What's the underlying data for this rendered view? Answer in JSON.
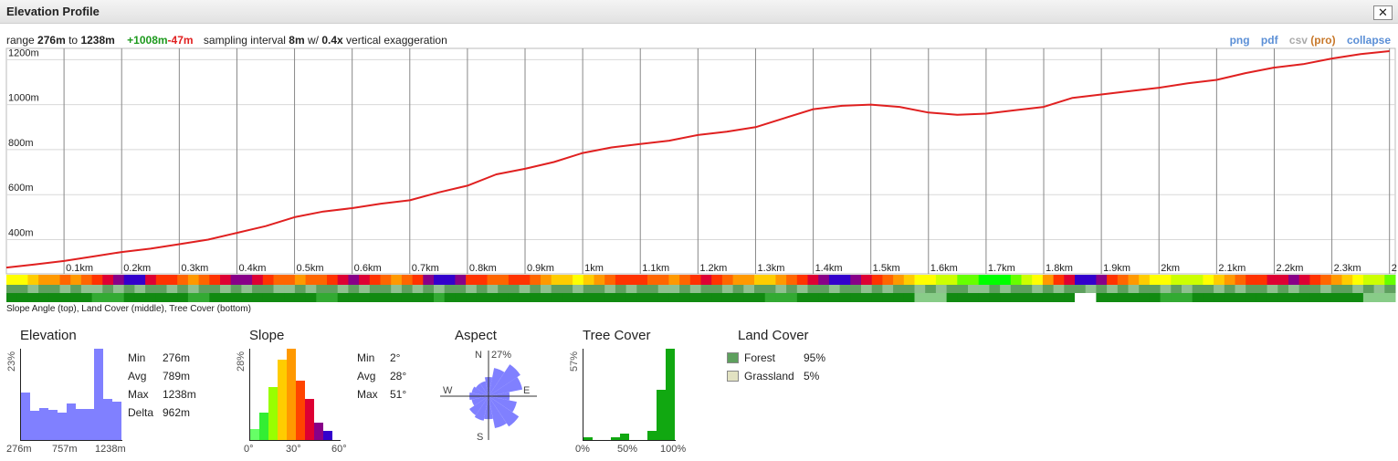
{
  "window": {
    "title": "Elevation Profile",
    "close_label": "✕"
  },
  "summary": {
    "range_prefix": "range",
    "range_min": "276m",
    "range_to": "to",
    "range_max": "1238m",
    "gain": "+1008m",
    "loss": "-47m",
    "sampling_prefix": "sampling interval",
    "sampling_value": "8m",
    "sampling_mid": "w/",
    "exaggeration_value": "0.4x",
    "exaggeration_suffix": "vertical exaggeration"
  },
  "tools": {
    "png": "png",
    "pdf": "pdf",
    "csv": "csv",
    "pro": "(pro)",
    "collapse": "collapse"
  },
  "colors": {
    "profile_line": "#e02020",
    "gain": "#1e9a1e",
    "loss": "#e02020",
    "link": "#5b8fd6",
    "histogram": "#8080ff",
    "tree_cover": "#11a811"
  },
  "chart_data": {
    "type": "line",
    "y_ticks": [
      "1200m",
      "1000m",
      "800m",
      "600m",
      "400m"
    ],
    "y_tick_values": [
      1200,
      1000,
      800,
      600,
      400
    ],
    "x_ticks": [
      "0.1km",
      "0.2km",
      "0.3km",
      "0.4km",
      "0.5km",
      "0.6km",
      "0.7km",
      "0.8km",
      "0.9km",
      "1km",
      "1.1km",
      "1.2km",
      "1.3km",
      "1.4km",
      "1.5km",
      "1.6km",
      "1.7km",
      "1.8km",
      "1.9km",
      "2km",
      "2.1km",
      "2.2km",
      "2.3km",
      "2"
    ],
    "x_tick_values": [
      0.1,
      0.2,
      0.3,
      0.4,
      0.5,
      0.6,
      0.7,
      0.8,
      0.9,
      1.0,
      1.1,
      1.2,
      1.3,
      1.4,
      1.5,
      1.6,
      1.7,
      1.8,
      1.9,
      2.0,
      2.1,
      2.2,
      2.3,
      2.4
    ],
    "x_range_km": [
      0,
      2.41
    ],
    "y_range_m": [
      248,
      1250
    ],
    "grid": true,
    "units": {
      "x": "km",
      "y": "m"
    },
    "series": [
      {
        "x_km": [
          0,
          0.05,
          0.1,
          0.15,
          0.2,
          0.25,
          0.3,
          0.35,
          0.4,
          0.45,
          0.5,
          0.55,
          0.6,
          0.65,
          0.7,
          0.75,
          0.8,
          0.85,
          0.9,
          0.95,
          1.0,
          1.05,
          1.1,
          1.15,
          1.2,
          1.25,
          1.3,
          1.35,
          1.4,
          1.45,
          1.5,
          1.55,
          1.6,
          1.65,
          1.7,
          1.75,
          1.8,
          1.85,
          1.9,
          1.95,
          2.0,
          2.05,
          2.1,
          2.15,
          2.2,
          2.25,
          2.3,
          2.35,
          2.4
        ],
        "elevation_m": [
          276,
          290,
          305,
          325,
          345,
          360,
          380,
          400,
          430,
          460,
          500,
          525,
          540,
          560,
          575,
          610,
          640,
          690,
          715,
          745,
          785,
          810,
          825,
          840,
          865,
          880,
          900,
          940,
          980,
          995,
          1000,
          990,
          965,
          955,
          960,
          975,
          990,
          1030,
          1045,
          1060,
          1075,
          1095,
          1110,
          1140,
          1165,
          1180,
          1205,
          1225,
          1238
        ]
      }
    ]
  },
  "strips": {
    "caption": "Slope Angle (top), Land Cover (middle), Tree Cover (bottom)",
    "slope_colors": [
      "#00ff00",
      "#66ff00",
      "#ccff00",
      "#ffff00",
      "#ffcc00",
      "#ff9900",
      "#ff6600",
      "#ff3300",
      "#dd0033",
      "#880088",
      "#3300cc"
    ],
    "slope_angles_deg": [
      18,
      20,
      24,
      26,
      28,
      30,
      29,
      32,
      36,
      40,
      44,
      50,
      48,
      40,
      36,
      34,
      30,
      28,
      30,
      34,
      38,
      42,
      44,
      40,
      36,
      32,
      30,
      28,
      30,
      32,
      36,
      40,
      42,
      38,
      34,
      30,
      28,
      32,
      36,
      44,
      48,
      46,
      42,
      36,
      34,
      30,
      32,
      36,
      34,
      30,
      28,
      24,
      22,
      20,
      22,
      26,
      30,
      34,
      36,
      34,
      32,
      30,
      28,
      30,
      34,
      38,
      36,
      32,
      28,
      26,
      24,
      22,
      26,
      30,
      34,
      40,
      44,
      48,
      46,
      42,
      38,
      34,
      30,
      26,
      22,
      20,
      18,
      16,
      14,
      12,
      10,
      8,
      6,
      8,
      10,
      14,
      20,
      28,
      34,
      38,
      46,
      50,
      44,
      36,
      30,
      26,
      22,
      20,
      18,
      16,
      14,
      16,
      18,
      22,
      26,
      30,
      34,
      36,
      38,
      40,
      42,
      38,
      34,
      30,
      26,
      22,
      18,
      16,
      14,
      12
    ],
    "land_cover_colors": [
      "#5ea05e",
      "#8fc08f"
    ],
    "land_cover_pattern": [
      0,
      0,
      1,
      0,
      0,
      1,
      0,
      1,
      1,
      0,
      1,
      0,
      1,
      0,
      0,
      1,
      0,
      1,
      0,
      0,
      1,
      0,
      1,
      0,
      0,
      1,
      1,
      0,
      1,
      0,
      0,
      1,
      0,
      1,
      0,
      0,
      1,
      0,
      1,
      0,
      1,
      0,
      0,
      1,
      0,
      1,
      0,
      0,
      1,
      0,
      1,
      0,
      0,
      1,
      0,
      0,
      1,
      0,
      1,
      0,
      0,
      1,
      1,
      0,
      1,
      0,
      0,
      1,
      0,
      1,
      0,
      0,
      1,
      0,
      1,
      0,
      0,
      1,
      0,
      0,
      1,
      0,
      1,
      0,
      0,
      1,
      0,
      1,
      0,
      0,
      1,
      1,
      0,
      1,
      0,
      0,
      1,
      0,
      1,
      0,
      0,
      1,
      0,
      1,
      0,
      1,
      0,
      0,
      1,
      0,
      1,
      0,
      0,
      1,
      0,
      1,
      0,
      0,
      1,
      0,
      1,
      0,
      0,
      1,
      0,
      0,
      1,
      0,
      1,
      0
    ],
    "tree_cover_colors": [
      "#118a11",
      "#33aa33",
      "#88cc88",
      "#ffffff"
    ],
    "tree_cover_pattern": [
      0,
      0,
      0,
      0,
      0,
      0,
      0,
      0,
      1,
      1,
      1,
      0,
      0,
      0,
      0,
      0,
      0,
      1,
      1,
      0,
      0,
      0,
      0,
      0,
      0,
      0,
      0,
      0,
      0,
      1,
      1,
      0,
      0,
      0,
      0,
      0,
      0,
      0,
      0,
      0,
      1,
      0,
      0,
      0,
      0,
      0,
      0,
      0,
      0,
      0,
      0,
      0,
      0,
      0,
      0,
      0,
      0,
      0,
      0,
      0,
      0,
      0,
      0,
      0,
      0,
      0,
      0,
      0,
      0,
      0,
      0,
      1,
      1,
      1,
      0,
      0,
      0,
      0,
      0,
      0,
      0,
      0,
      0,
      0,
      0,
      2,
      2,
      2,
      0,
      0,
      0,
      0,
      0,
      0,
      0,
      0,
      0,
      0,
      0,
      0,
      3,
      3,
      0,
      0,
      0,
      0,
      0,
      0,
      1,
      1,
      1,
      0,
      0,
      0,
      0,
      0,
      0,
      0,
      0,
      0,
      0,
      0,
      0,
      0,
      0,
      0,
      0,
      2,
      2,
      2
    ]
  },
  "panels": {
    "elevation": {
      "title": "Elevation",
      "peak_pct": "23%",
      "stats": [
        {
          "k": "Min",
          "v": "276m"
        },
        {
          "k": "Avg",
          "v": "789m"
        },
        {
          "k": "Max",
          "v": "1238m"
        },
        {
          "k": "Delta",
          "v": "962m"
        }
      ],
      "axis": [
        "276m",
        "757m",
        "1238m"
      ],
      "histogram": [
        0.52,
        0.32,
        0.35,
        0.33,
        0.3,
        0.4,
        0.34,
        0.34,
        1.0,
        0.45,
        0.42
      ]
    },
    "slope": {
      "title": "Slope",
      "peak_pct": "28%",
      "stats": [
        {
          "k": "Min",
          "v": "2°"
        },
        {
          "k": "Avg",
          "v": "28°"
        },
        {
          "k": "Max",
          "v": "51°"
        }
      ],
      "axis": [
        "0°",
        "30°",
        "60°"
      ],
      "histogram": [
        0.12,
        0.3,
        0.58,
        0.88,
        1.0,
        0.65,
        0.45,
        0.19,
        0.1
      ],
      "colors": [
        "#66ff66",
        "#33ee33",
        "#99ff00",
        "#ffcc00",
        "#ff9900",
        "#ff4400",
        "#dd0033",
        "#880088",
        "#3300cc"
      ]
    },
    "aspect": {
      "title": "Aspect",
      "peak_pct": "27%",
      "labels": {
        "n": "N",
        "e": "E",
        "s": "S",
        "w": "W"
      },
      "petals": [
        0.5,
        0.75,
        1.0,
        0.9,
        0.55,
        0.75,
        0.95,
        0.85,
        0.6,
        0.65,
        0.6,
        0.45,
        0.5,
        0.45,
        0.4,
        0.4
      ]
    },
    "tree_cover": {
      "title": "Tree Cover",
      "peak_pct": "57%",
      "axis": [
        "0%",
        "50%",
        "100%"
      ],
      "histogram": [
        0.03,
        0.0,
        0.0,
        0.03,
        0.07,
        0.0,
        0.0,
        0.1,
        0.55,
        1.0
      ]
    },
    "land_cover": {
      "title": "Land Cover",
      "items": [
        {
          "label": "Forest",
          "pct": "95%",
          "color": "#5ea05e"
        },
        {
          "label": "Grassland",
          "pct": "5%",
          "color": "#e2e2c2"
        }
      ]
    }
  }
}
